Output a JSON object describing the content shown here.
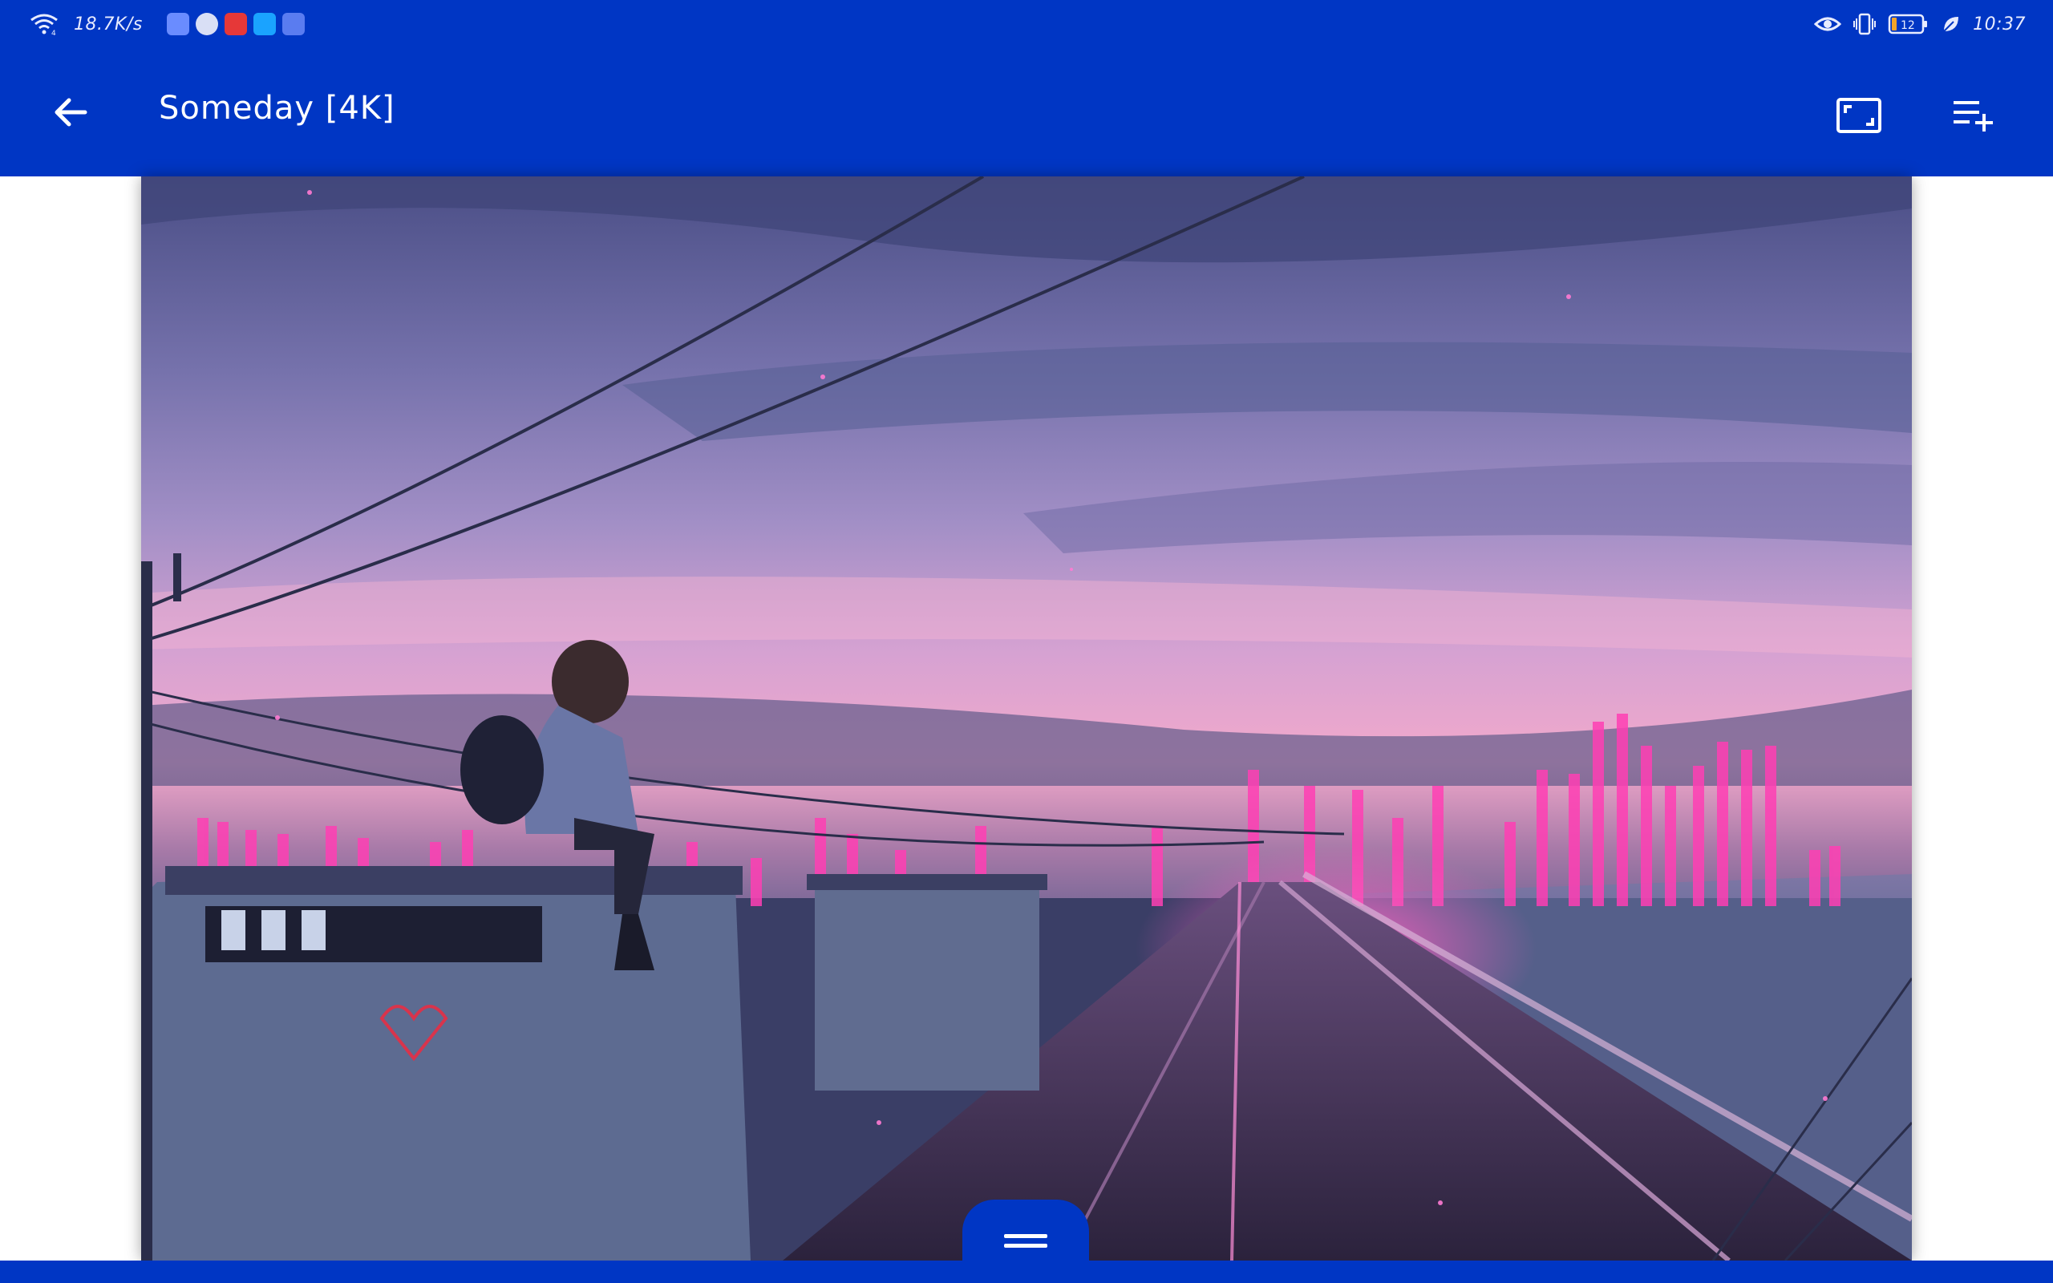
{
  "status_bar": {
    "network_speed": "18.7K/s",
    "battery_level": "12",
    "time": "10:37",
    "icons": [
      "wifi-icon",
      "music-app-icon",
      "browser-app-icon",
      "huawei-app-icon",
      "search-app-icon",
      "tips-app-icon",
      "eye-comfort-icon",
      "vibrate-icon",
      "battery-icon",
      "power-saving-leaf-icon"
    ]
  },
  "app_bar": {
    "title": "Someday [4K]",
    "icons": [
      "back-arrow-icon",
      "fit-screen-icon",
      "playlist-add-icon"
    ]
  },
  "preview": {
    "content": "wallpaper-preview-image"
  },
  "bottom_handle": {
    "icon": "drag-handle-icon"
  },
  "colors": {
    "primary": "#0036c4",
    "on_primary": "#ffffff",
    "background": "#ffffff"
  }
}
